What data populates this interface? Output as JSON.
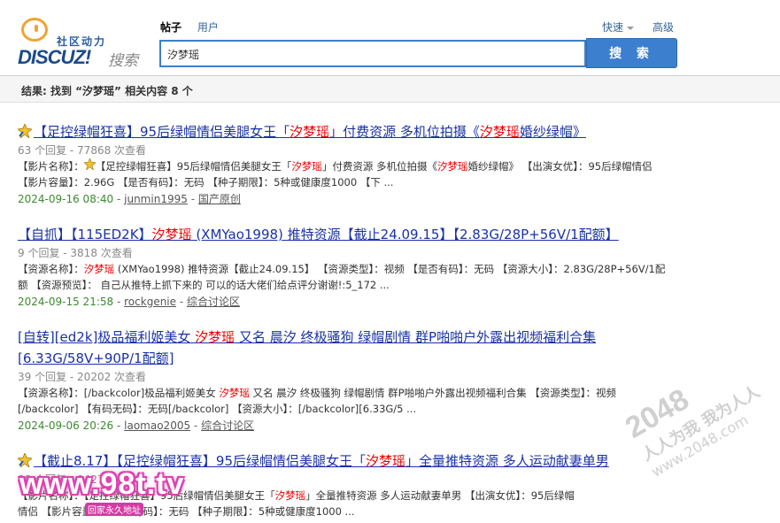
{
  "header": {
    "logo_tagline": "社区动力",
    "logo_brand": "DISCUZ!",
    "logo_search": "搜索",
    "tabs": [
      {
        "label": "帖子",
        "active": true
      },
      {
        "label": "用户",
        "active": false
      }
    ],
    "search_value": "汐梦瑶",
    "search_button": "搜 索",
    "quick_label": "快速",
    "advanced_label": "高级"
  },
  "result_summary": "结果: 找到 “汐梦瑶” 相关内容 8 个",
  "results": [
    {
      "title_parts": [
        "【足控绿帽狂喜】95后绿帽情侣美腿女王「",
        "汐梦瑶",
        "」付费资源 多机位拍摄《",
        "汐梦瑶",
        "婚纱绿帽》"
      ],
      "has_icon": true,
      "meta": "63 个回复 - 77868 次查看",
      "desc_line1_parts": [
        "【影片名称】：",
        "【足控绿帽狂喜】95后绿帽情侣美腿女王「",
        "汐梦瑶",
        "」付费资源 多机位拍摄《",
        "汐梦瑶",
        "婚纱绿帽》 【出演女优】：95后绿帽情侣"
      ],
      "desc_line2": "【影片容量】：2.96G 【是否有码】：无码 【种子期限】：5种或健康度1000 【下 ...",
      "date": "2024-09-16 08:40",
      "author": "junmin1995",
      "forum": "国产原创"
    },
    {
      "title_parts": [
        "【自抓】【115ED2K】",
        "汐梦瑶",
        " (XMYao1998) 推特资源【截止24.09.15】【2.83G/28P+56V/1配额】"
      ],
      "has_icon": false,
      "meta": "9 个回复 - 3818 次查看",
      "desc_line1_parts": [
        "【资源名称】：",
        "汐梦瑶",
        " (XMYao1998) 推特资源【截止24.09.15】 【资源类型】：视频 【是否有码】：无码 【资源大小】：2.83G/28P+56V/1配"
      ],
      "desc_line2": "额 【资源预览】： 自己从推特上抓下来的 可以的话大佬们给点评分谢谢!:5_172 ...",
      "date": "2024-09-15 21:58",
      "author": "rockgenie",
      "forum": "综合讨论区"
    },
    {
      "title_parts": [
        "[自转][ed2k]极品福利姬美女 ",
        "汐梦瑶",
        " 又名 晨汐 终极骚狗 绿帽剧情 群P啪啪户外露出视频福利合集"
      ],
      "title_line2": "[6.33G/58V+90P/1配额]",
      "has_icon": false,
      "meta": "39 个回复 - 20202 次查看",
      "desc_line1_parts": [
        "【资源名称】：[/backcolor]极品福利姬美女 ",
        "汐梦瑶",
        " 又名 晨汐 终极骚狗 绿帽剧情 群P啪啪户外露出视频福利合集 【资源类型】：视频"
      ],
      "desc_line2": "[/backcolor] 【有码无码】：无码[/backcolor] 【资源大小】：[/backcolor][6.33G/5 ...",
      "date": "2024-09-06 20:26",
      "author": "laomao2005",
      "forum": "综合讨论区"
    },
    {
      "title_parts": [
        "【截止8.17】【足控绿帽狂喜】95后绿帽情侣美腿女王「",
        "汐梦瑶",
        "」全量推特资源 多人运动献妻单男"
      ],
      "has_icon": true,
      "meta": "88 个回复 - 94274 次查看",
      "desc_line1_parts": [
        "【影片名称】：【足控绿帽狂喜】95后绿帽情侣美腿女王「",
        "汐梦瑶",
        "」全量推特资源 多人运动献妻单男 【出演女优】：95后绿帽"
      ],
      "desc_line2": "情侣 【影片容量】：【是否有码】：无码 【种子期限】：5种或健康度1000 ...",
      "date": "",
      "author": "",
      "forum": ""
    }
  ],
  "watermarks": {
    "site": "www.98t.tv",
    "site_sub": "回家永久地址",
    "right_big": "2048",
    "right_mid": "人人为我 我为人人",
    "right_url": "www.2048.com"
  }
}
